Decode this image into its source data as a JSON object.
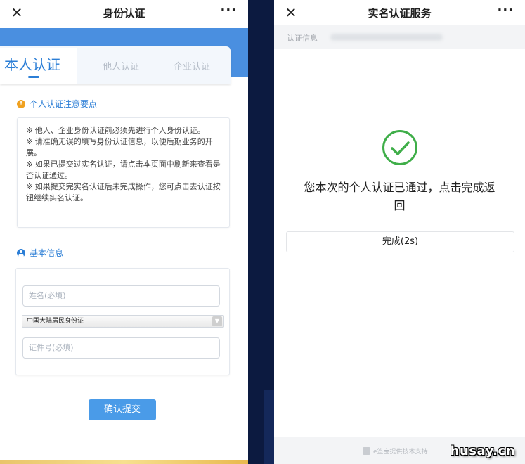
{
  "left_screen": {
    "title": "身份认证",
    "more_label": "···",
    "tabs": [
      {
        "label": "本人认证",
        "active": true
      },
      {
        "label": "他人认证",
        "active": false
      },
      {
        "label": "企业认证",
        "active": false
      }
    ],
    "notice": {
      "heading": "个人认证注意要点",
      "lines": [
        "※ 他人、企业身份认证前必须先进行个人身份认证。",
        "※ 请准确无误的填写身份认证信息，以便后期业务的开展。",
        "※ 如果已提交过实名认证，请点击本页面中刷新来查看是否认证通过。",
        "※ 如果提交完实名认证后未完成操作，您可点击去认证按钮继续实名认证。"
      ]
    },
    "basic_info": {
      "heading": "基本信息",
      "name_placeholder": "姓名(必填)",
      "id_type_selected": "中国大陆居民身份证",
      "id_number_placeholder": "证件号(必填)"
    },
    "submit_label": "确认提交"
  },
  "right_screen": {
    "title": "实名认证服务",
    "more_label": "···",
    "info_label": "认证信息",
    "result_text": "您本次的个人认证已通过，点击完成返回",
    "done_label": "完成(2s)",
    "footer_text": "e签宝提供技术支持"
  },
  "watermark": "husay.cn",
  "colors": {
    "accent_blue": "#2b7ed6",
    "band_blue": "#4a8fe0",
    "success_green": "#3fae49",
    "warning_orange": "#f0a120"
  }
}
